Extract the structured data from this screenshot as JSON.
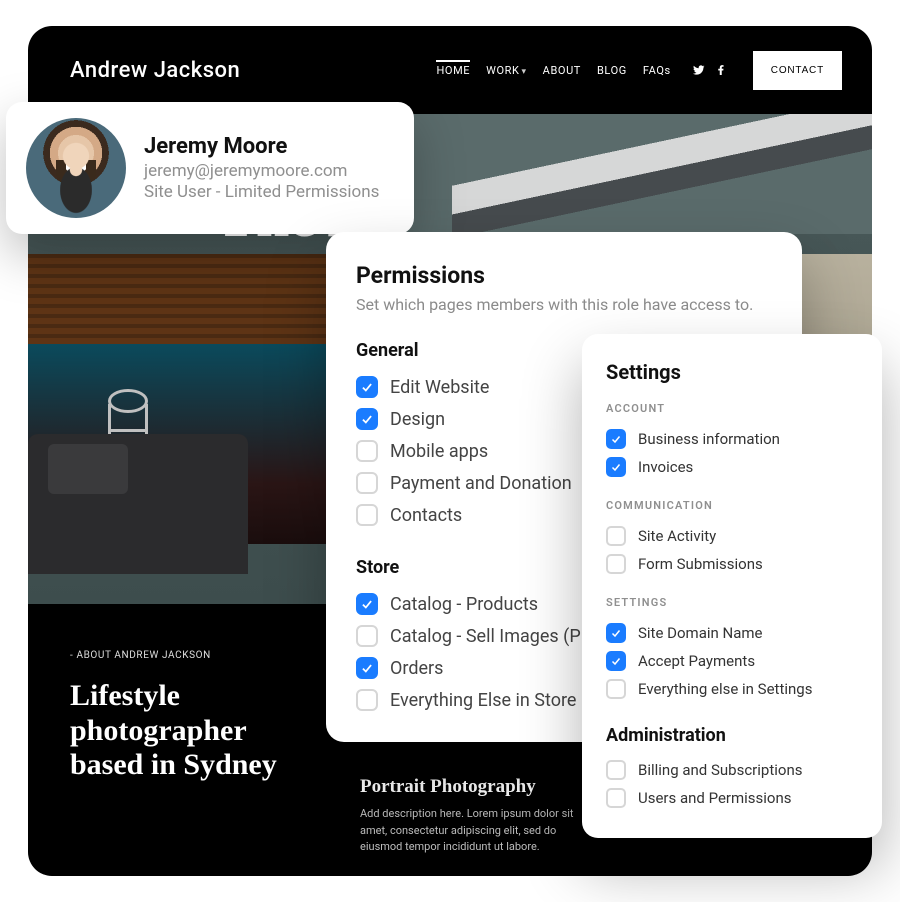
{
  "site": {
    "name": "Andrew Jackson",
    "nav": {
      "home": "HOME",
      "work": "WORK",
      "about": "ABOUT",
      "blog": "BLOG",
      "faqs": "FAQs"
    },
    "contact_label": "CONTACT",
    "hero_title": "The A",
    "about": {
      "eyebrow": "- ABOUT ANDREW JACKSON",
      "heading": "Lifestyle photographer based in Sydney"
    },
    "portrait": {
      "heading": "Portrait Photography",
      "desc": "Add description here. Lorem ipsum dolor sit amet, consectetur adipiscing elit, sed do eiusmod tempor incididunt ut labore."
    }
  },
  "user": {
    "name": "Jeremy Moore",
    "email": "jeremy@jeremymoore.com",
    "role": "Site User - Limited Permissions"
  },
  "permissions": {
    "title": "Permissions",
    "subtitle": "Set which pages members with this role have access to.",
    "groups": [
      {
        "title": "General",
        "items": [
          {
            "label": "Edit Website",
            "checked": true
          },
          {
            "label": "Design",
            "checked": true
          },
          {
            "label": "Mobile apps",
            "checked": false
          },
          {
            "label": "Payment and Donation",
            "checked": false
          },
          {
            "label": "Contacts",
            "checked": false
          }
        ]
      },
      {
        "title": "Store",
        "items": [
          {
            "label": "Catalog - Products",
            "checked": true
          },
          {
            "label": "Catalog - Sell Images (P",
            "checked": false
          },
          {
            "label": "Orders",
            "checked": true
          },
          {
            "label": "Everything Else in Store",
            "checked": false
          }
        ]
      }
    ]
  },
  "settings": {
    "title": "Settings",
    "groups": [
      {
        "label": "ACCOUNT",
        "items": [
          {
            "label": "Business information",
            "checked": true
          },
          {
            "label": "Invoices",
            "checked": true
          }
        ]
      },
      {
        "label": "COMMUNICATION",
        "items": [
          {
            "label": "Site Activity",
            "checked": false
          },
          {
            "label": "Form Submissions",
            "checked": false
          }
        ]
      },
      {
        "label": "SETTINGS",
        "items": [
          {
            "label": "Site Domain Name",
            "checked": true
          },
          {
            "label": "Accept Payments",
            "checked": true
          },
          {
            "label": "Everything else in Settings",
            "checked": false
          }
        ]
      }
    ],
    "administration": {
      "title": "Administration",
      "items": [
        {
          "label": "Billing and Subscriptions",
          "checked": false
        },
        {
          "label": "Users and Permissions",
          "checked": false
        }
      ]
    }
  },
  "colors": {
    "accent": "#1a7cff"
  }
}
